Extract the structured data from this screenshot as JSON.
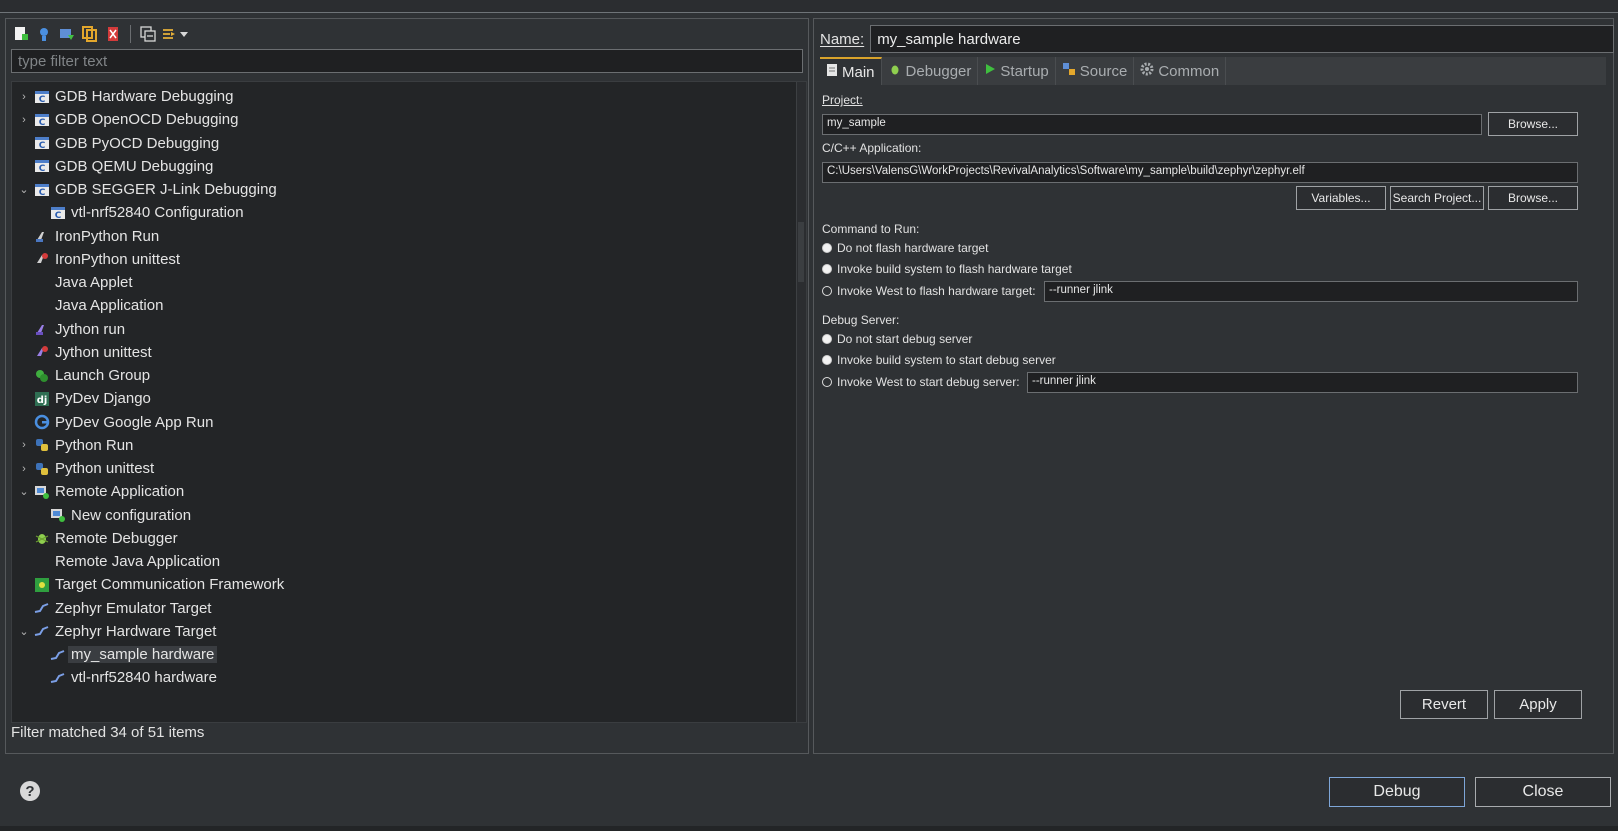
{
  "toolbar": {
    "buttons": [
      {
        "icon": "new-config-icon"
      },
      {
        "icon": "new-prototype-icon"
      },
      {
        "icon": "export-icon"
      },
      {
        "icon": "duplicate-icon"
      },
      {
        "icon": "delete-icon"
      },
      {
        "icon": "collapse-all-icon"
      },
      {
        "icon": "filter-icon"
      }
    ]
  },
  "filter": {
    "placeholder": "type filter text"
  },
  "tree": {
    "items": [
      {
        "label": "GDB Hardware Debugging",
        "twisty": "›",
        "indent": 0,
        "icon": "c-icon"
      },
      {
        "label": "GDB OpenOCD Debugging",
        "twisty": "›",
        "indent": 0,
        "icon": "c-icon"
      },
      {
        "label": "GDB PyOCD Debugging",
        "twisty": "",
        "indent": 0,
        "icon": "c-icon"
      },
      {
        "label": "GDB QEMU Debugging",
        "twisty": "",
        "indent": 0,
        "icon": "c-icon"
      },
      {
        "label": "GDB SEGGER J-Link Debugging",
        "twisty": "⌄",
        "indent": 0,
        "icon": "c-icon"
      },
      {
        "label": "vtl-nrf52840 Configuration",
        "twisty": "",
        "indent": 1,
        "icon": "c-icon"
      },
      {
        "label": "IronPython Run",
        "twisty": "",
        "indent": 0,
        "icon": "python-run-icon"
      },
      {
        "label": "IronPython unittest",
        "twisty": "",
        "indent": 0,
        "icon": "python-test-icon"
      },
      {
        "label": "Java Applet",
        "twisty": "",
        "indent": 0,
        "icon": "none"
      },
      {
        "label": "Java Application",
        "twisty": "",
        "indent": 0,
        "icon": "none"
      },
      {
        "label": "Jython run",
        "twisty": "",
        "indent": 0,
        "icon": "jython-run-icon"
      },
      {
        "label": "Jython unittest",
        "twisty": "",
        "indent": 0,
        "icon": "jython-test-icon"
      },
      {
        "label": "Launch Group",
        "twisty": "",
        "indent": 0,
        "icon": "launch-group-icon"
      },
      {
        "label": "PyDev Django",
        "twisty": "",
        "indent": 0,
        "icon": "django-icon"
      },
      {
        "label": "PyDev Google App Run",
        "twisty": "",
        "indent": 0,
        "icon": "google-icon"
      },
      {
        "label": "Python Run",
        "twisty": "›",
        "indent": 0,
        "icon": "python-icon"
      },
      {
        "label": "Python unittest",
        "twisty": "›",
        "indent": 0,
        "icon": "python-icon"
      },
      {
        "label": "Remote Application",
        "twisty": "⌄",
        "indent": 0,
        "icon": "remote-app-icon"
      },
      {
        "label": "New configuration",
        "twisty": "",
        "indent": 1,
        "icon": "remote-app-icon"
      },
      {
        "label": "Remote Debugger",
        "twisty": "",
        "indent": 0,
        "icon": "bug-icon"
      },
      {
        "label": "Remote Java Application",
        "twisty": "",
        "indent": 0,
        "icon": "none"
      },
      {
        "label": "Target Communication Framework",
        "twisty": "",
        "indent": 0,
        "icon": "tcf-icon"
      },
      {
        "label": "Zephyr Emulator Target",
        "twisty": "",
        "indent": 0,
        "icon": "zephyr-icon"
      },
      {
        "label": "Zephyr Hardware Target",
        "twisty": "⌄",
        "indent": 0,
        "icon": "zephyr-icon"
      },
      {
        "label": "my_sample hardware",
        "twisty": "",
        "indent": 1,
        "icon": "zephyr-icon",
        "selected": true
      },
      {
        "label": "vtl-nrf52840 hardware",
        "twisty": "",
        "indent": 1,
        "icon": "zephyr-icon"
      }
    ]
  },
  "status": "Filter matched 34 of 51 items",
  "config": {
    "name_label": "Name:",
    "name_value": "my_sample hardware",
    "tabs": [
      {
        "label": "Main",
        "icon": "page-icon",
        "active": true
      },
      {
        "label": "Debugger",
        "icon": "bug-icon"
      },
      {
        "label": "Startup",
        "icon": "play-icon"
      },
      {
        "label": "Source",
        "icon": "source-icon"
      },
      {
        "label": "Common",
        "icon": "gear-icon"
      }
    ],
    "project_label": "Project:",
    "project_value": "my_sample",
    "browse_label": "Browse...",
    "app_label": "C/C++ Application:",
    "app_value": "C:\\Users\\ValensG\\WorkProjects\\RevivalAnalytics\\Software\\my_sample\\build\\zephyr\\zephyr.elf",
    "variables_label": "Variables...",
    "search_project_label": "Search Project...",
    "command_label": "Command to Run:",
    "command_options": [
      {
        "label": "Do not flash hardware target",
        "checked": false
      },
      {
        "label": "Invoke build system to flash hardware target",
        "checked": false
      },
      {
        "label": "Invoke West to flash hardware target:",
        "checked": true,
        "value": "--runner jlink"
      }
    ],
    "debug_label": "Debug Server:",
    "debug_options": [
      {
        "label": "Do not start debug server",
        "checked": false
      },
      {
        "label": "Invoke build system to start debug server",
        "checked": false
      },
      {
        "label": "Invoke West to start debug server:",
        "checked": true,
        "value": "--runner jlink"
      }
    ],
    "revert_label": "Revert",
    "apply_label": "Apply"
  },
  "footer": {
    "help": "?",
    "debug_label": "Debug",
    "close_label": "Close"
  },
  "colors": {
    "background": "#2f3235",
    "tree_background": "#232527",
    "accent_tab": "#d9a32b",
    "primary_border": "#7ea6d8"
  }
}
